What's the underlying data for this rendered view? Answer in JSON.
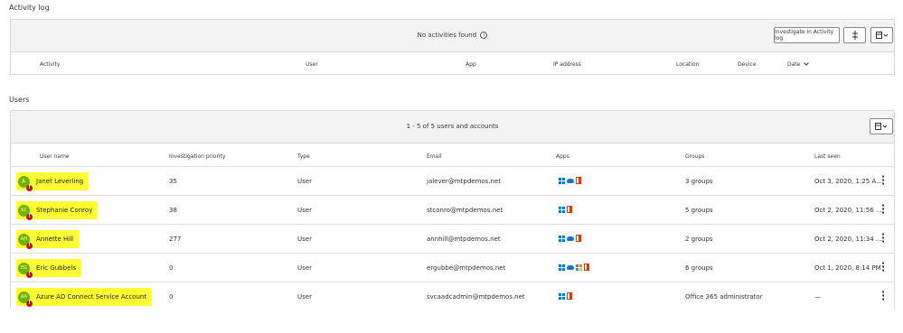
{
  "activity_log": {
    "title": "Activity log",
    "empty_message": "No activities found",
    "info_icon": "info-icon",
    "investigate_button": "Investigate in Activity log",
    "filter_icon": "column-adjust-icon",
    "columns_icon": "column-settings-icon",
    "columns": [
      "Activity",
      "User",
      "App",
      "IP address",
      "Location",
      "Device",
      "Date"
    ],
    "date_sort_icon": "chevron-down-icon"
  },
  "users": {
    "title": "Users",
    "count_text": "1 - 5 of 5 users and accounts",
    "columns_icon": "column-settings-icon",
    "columns": [
      "User name",
      "Investigation priority",
      "Type",
      "Email",
      "Apps",
      "Groups",
      "Last seen"
    ],
    "rows": [
      {
        "name": "Janet Leverling",
        "priority": "35",
        "type": "User",
        "email": "jalever@mtpdemos.net",
        "apps": [
          "windows-icon",
          "onedrive-icon",
          "office-icon"
        ],
        "groups": "3 groups",
        "last_seen": "Oct 3, 2020, 1:25 A..."
      },
      {
        "name": "Stephanie Conroy",
        "priority": "38",
        "type": "User",
        "email": "stconro@mtpdemos.net",
        "apps": [
          "windows-icon",
          "office-icon"
        ],
        "groups": "5 groups",
        "last_seen": "Oct 2, 2020, 11:56 ..."
      },
      {
        "name": "Annette Hill",
        "priority": "277",
        "type": "User",
        "email": "annhill@mtpdemos.net",
        "apps": [
          "windows-icon",
          "onedrive-icon",
          "office-icon"
        ],
        "groups": "2 groups",
        "last_seen": "Oct 2, 2020, 11:34 ..."
      },
      {
        "name": "Eric Gubbels",
        "priority": "0",
        "type": "User",
        "email": "ergubbe@mtpdemos.net",
        "apps": [
          "windows-icon",
          "onedrive-icon",
          "store-icon",
          "office-icon"
        ],
        "groups": "6 groups",
        "last_seen": "Oct 1, 2020, 8:14 PM"
      },
      {
        "name": "Azure AD Connect Service Account",
        "priority": "0",
        "type": "User",
        "email": "svcaadcadmin@mtpdemos.net",
        "apps": [
          "windows-icon",
          "office-icon"
        ],
        "groups": "Office 365 administrator",
        "last_seen": "—"
      }
    ]
  },
  "colors": {
    "highlight": "#ffff33",
    "avatar": "#71b300",
    "warning": "#c50f1f",
    "header_bg": "#f3f3f3"
  }
}
